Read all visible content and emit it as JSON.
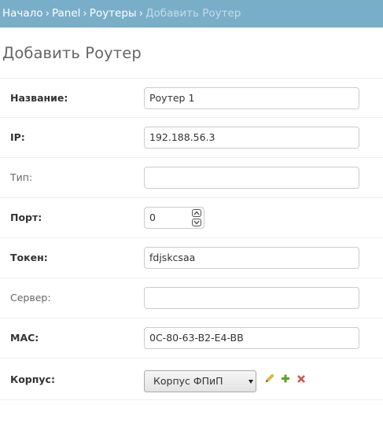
{
  "breadcrumbs": {
    "items": [
      "Начало",
      "Panel",
      "Роутеры"
    ],
    "separator": "›",
    "current": "Добавить Роутер"
  },
  "page": {
    "title": "Добавить Роутер"
  },
  "form": {
    "name": {
      "label": "Название:",
      "value": "Роутер 1"
    },
    "ip": {
      "label": "IP:",
      "value": "192.188.56.3"
    },
    "type": {
      "label": "Тип:",
      "value": ""
    },
    "port": {
      "label": "Порт:",
      "value": "0"
    },
    "token": {
      "label": "Токен:",
      "value": "fdjskcsaa"
    },
    "server": {
      "label": "Сервер:",
      "value": ""
    },
    "mac": {
      "label": "MAC:",
      "value": "0C-80-63-B2-E4-BB"
    },
    "building": {
      "label": "Корпус:",
      "selected": "Корпус ФПиП"
    }
  },
  "icons": {
    "edit": "pencil-icon",
    "add": "plus-icon",
    "delete": "x-icon"
  },
  "colors": {
    "header_bg": "#79aec8",
    "breadcrumb_link": "#ffffff",
    "breadcrumb_current": "#c4dce8",
    "edit_icon": "#e6c42a",
    "add_icon": "#5fa225",
    "delete_icon": "#d9534f"
  }
}
